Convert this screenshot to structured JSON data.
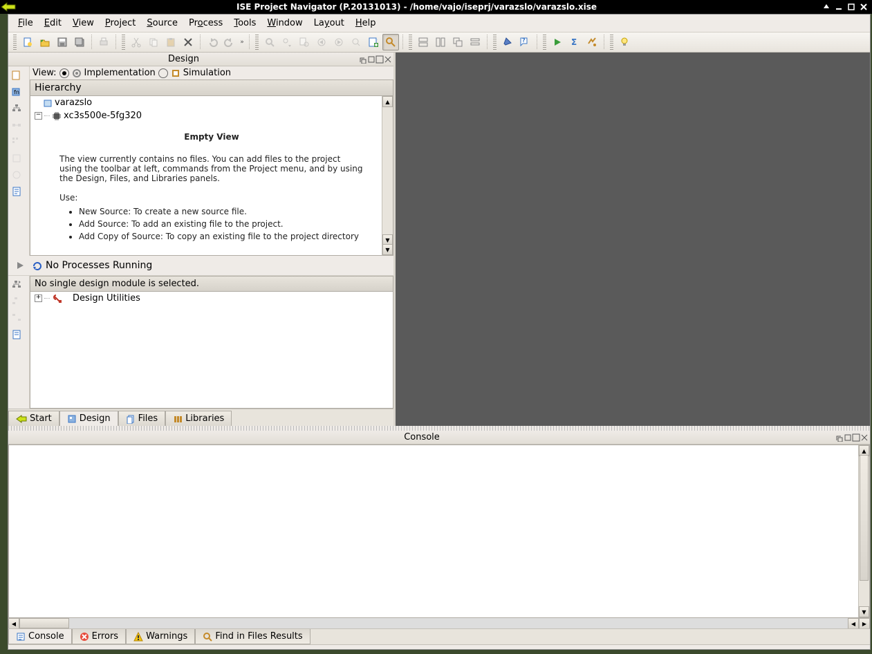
{
  "window": {
    "title": "ISE Project Navigator (P.20131013) - /home/vajo/iseprj/varazslo/varazslo.xise"
  },
  "menu": {
    "file": "File",
    "edit": "Edit",
    "view": "View",
    "project": "Project",
    "source": "Source",
    "process": "Process",
    "tools": "Tools",
    "window": "Window",
    "layout": "Layout",
    "help": "Help"
  },
  "design_panel_title": "Design",
  "view": {
    "label": "View:",
    "implementation": "Implementation",
    "simulation": "Simulation"
  },
  "hierarchy": {
    "title": "Hierarchy",
    "project": "varazslo",
    "device": "xc3s500e-5fg320",
    "empty_title": "Empty View",
    "empty_body": "The view currently contains no files. You can add files to the project using the toolbar at left, commands from the Project menu, and by using the Design, Files, and Libraries panels.",
    "use_label": "Use:",
    "bullets": [
      "New Source: To create a new source file.",
      "Add Source: To add an existing file to the project.",
      "Add Copy of Source: To copy an existing file to the project directory"
    ]
  },
  "processes": {
    "status": "No Processes Running",
    "header": "No single design module is selected.",
    "utilities": "Design Utilities"
  },
  "left_tabs": {
    "start": "Start",
    "design": "Design",
    "files": "Files",
    "libraries": "Libraries"
  },
  "console": {
    "panel_title": "Console",
    "tabs": {
      "console": "Console",
      "errors": "Errors",
      "warnings": "Warnings",
      "find": "Find in Files Results"
    }
  }
}
